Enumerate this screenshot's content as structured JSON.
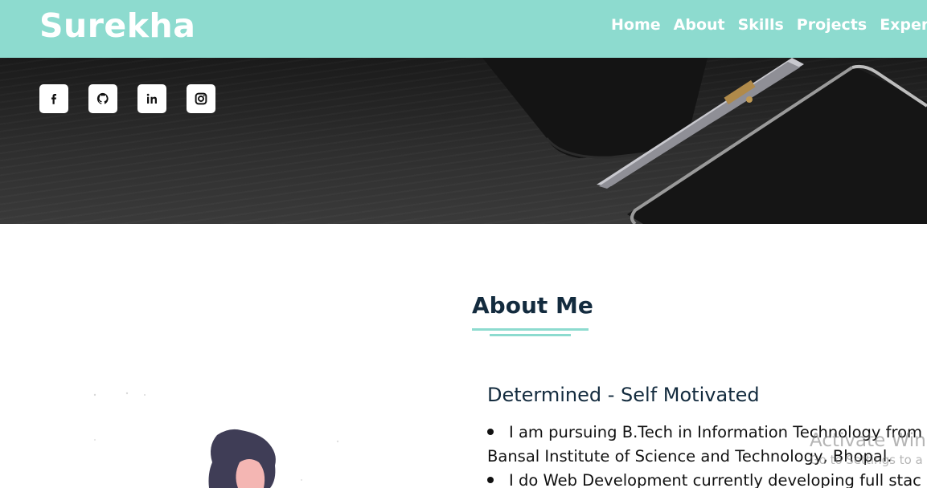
{
  "header": {
    "brand": "Surekha",
    "nav": [
      "Home",
      "About",
      "Skills",
      "Projects",
      "Experienc"
    ]
  },
  "hero": {
    "socials": [
      {
        "name": "facebook-icon"
      },
      {
        "name": "github-icon"
      },
      {
        "name": "linkedin-icon"
      },
      {
        "name": "instagram-icon"
      }
    ]
  },
  "about": {
    "title": "About Me",
    "subtitle": "Determined - Self Motivated",
    "bullet1_line1": "I am pursuing B.Tech in Information Technology from",
    "bullet1_line2": "Bansal Institute of Science and Technology, Bhopal.",
    "bullet2": "I do Web Development currently developing full stac"
  },
  "watermark": {
    "line1": "Activate Wind",
    "line2": "Go to Settings to a"
  },
  "colors": {
    "accent": "#8ddbcf",
    "heading": "#132b3e"
  }
}
